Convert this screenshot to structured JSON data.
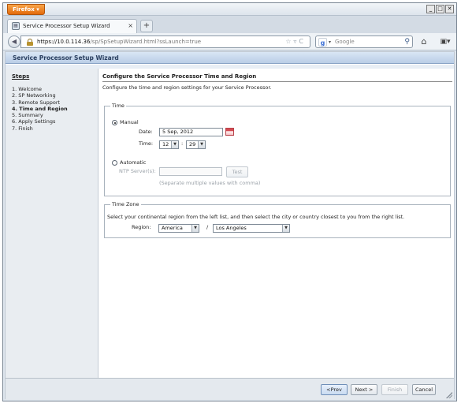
{
  "browser": {
    "menu_label": "Firefox",
    "tab_title": "Service Processor Setup Wizard",
    "new_tab_label": "+",
    "url_host": "https://10.0.114.36",
    "url_path": "/sp/SpSetupWizard.html?ssLaunch=true",
    "search_placeholder": "Google",
    "window_buttons": [
      "_",
      "□",
      "✕"
    ]
  },
  "wizard": {
    "header_title": "Service Processor Setup Wizard",
    "steps_title": "Steps",
    "steps": [
      "1.  Welcome",
      "2.  SP Networking",
      "3.  Remote Support",
      "4.  Time and Region",
      "5.  Summary",
      "6.  Apply Settings",
      "7.  Finish"
    ],
    "current_step_index": 3
  },
  "main": {
    "title": "Configure the Service Processor Time and Region",
    "description": "Configure the time and region settings for your Service Processor."
  },
  "time_section": {
    "legend": "Time",
    "manual_label": "Manual",
    "manual_selected": true,
    "date_label": "Date:",
    "date_value": "5 Sep, 2012",
    "time_label": "Time:",
    "hour_value": "12",
    "time_separator": ":",
    "minute_value": "29",
    "automatic_label": "Automatic",
    "automatic_selected": false,
    "ntp_label": "NTP Server(s):",
    "ntp_value": "",
    "test_button": "Test",
    "ntp_hint": "(Separate multiple values with comma)"
  },
  "zone_section": {
    "legend": "Time Zone",
    "instruction": "Select your continental region from the left list, and then select the city or country closest to you from the right list.",
    "region_label": "Region:",
    "region_value": "America",
    "separator": "/",
    "city_value": "Los Angeles"
  },
  "footer": {
    "prev_label": "<Prev",
    "next_label": "Next >",
    "finish_label": "Finish",
    "cancel_label": "Cancel"
  }
}
